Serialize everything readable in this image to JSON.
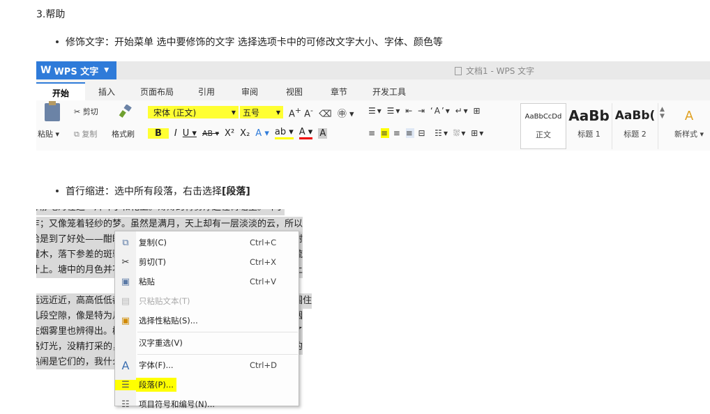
{
  "section_title": "3.帮助",
  "bullet1": "修饰文字：开始菜单  选中要修饰的文字    选择选项卡中的可修改文字大小、字体、颜色等",
  "bullet2_prefix": "首行缩进：选中所有段落，右击选择",
  "bullet2_bold": "[段落]",
  "wps": {
    "app_label": "WPS 文字",
    "doc_title": "文档1 - WPS 文字",
    "tabs": [
      "开始",
      "插入",
      "页面布局",
      "引用",
      "审阅",
      "视图",
      "章节",
      "开发工具"
    ],
    "ribbon": {
      "cut": "剪切",
      "paste": "粘贴",
      "copy": "复制",
      "format_painter": "格式刷",
      "font_name": "宋体 (正文)",
      "font_size": "五号",
      "styles": [
        {
          "preview": "AaBbCcDd",
          "label": "正文"
        },
        {
          "preview": "AaBb",
          "label": "标题 1"
        },
        {
          "preview": "AaBb(",
          "label": "标题 2"
        }
      ],
      "new_style": "新样式"
    }
  },
  "doc_lines": [
    "静静地泻在这一片叶子和花上。薄薄的青雾浮起在荷塘里。叶子",
    "乍；又像笼着轻纱的梦。虽然是满月，天上却有一层淡淡的云，所以",
    "恰是到了好处——酣眠固不可少，小睡也别有风味的。月光是隔了树",
    "灌木，落下参差的斑驳的黑影，峭楞楞如鬼一般；弯弯的杨柳的稀疏",
    "叶上。塘中的月色并不均匀；但光与影有着和谐的旋律，如梵婀玲上",
    "远远近近，高高低低都是树，而杨柳最多。这些树将一片荷塘重重围住",
    "几段空隙，像是特为月光留下的。树色一例是阴阴的，乍看像一团烟",
    "在烟雾里也辨得出。树梢上隐隐约约的是一带远山，只有些大意罢了",
    "路灯光，没精打采的，是渴睡人的眼。这时候最热闹的，要数树上的",
    "热闹是它们的，我什么也没有。"
  ],
  "context_menu": [
    {
      "icon": "copy-icon",
      "label": "复制(C)",
      "shortcut": "Ctrl+C",
      "disabled": false
    },
    {
      "icon": "cut-icon",
      "label": "剪切(T)",
      "shortcut": "Ctrl+X",
      "disabled": false
    },
    {
      "icon": "paste-icon",
      "label": "粘贴",
      "shortcut": "Ctrl+V",
      "disabled": false
    },
    {
      "icon": "paste-text-icon",
      "label": "只粘贴文本(T)",
      "shortcut": "",
      "disabled": true
    },
    {
      "icon": "paste-special-icon",
      "label": "选择性粘贴(S)...",
      "shortcut": "",
      "disabled": false
    },
    {
      "icon": "",
      "label": "汉字重选(V)",
      "shortcut": "",
      "disabled": false
    },
    {
      "icon": "font-icon",
      "label": "字体(F)...",
      "shortcut": "Ctrl+D",
      "disabled": false
    },
    {
      "icon": "paragraph-icon",
      "label": "段落(P)...",
      "shortcut": "",
      "disabled": false
    },
    {
      "icon": "list-icon",
      "label": "项目符号和编号(N)...",
      "shortcut": "",
      "disabled": false
    }
  ]
}
